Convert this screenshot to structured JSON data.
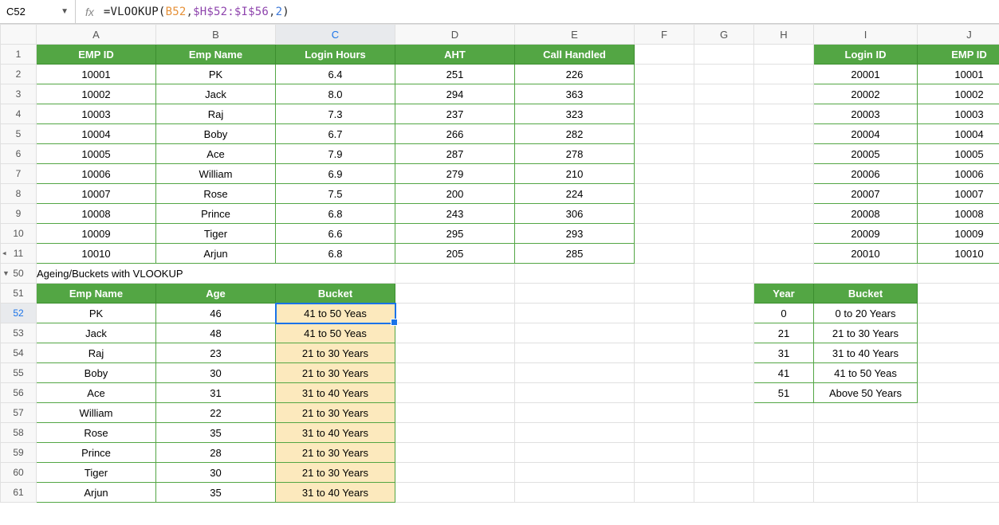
{
  "namebox": "C52",
  "fx_label": "fx",
  "formula": {
    "fn": "=VLOOKUP",
    "arg1": "B52",
    "arg2": "$H$52:$I$56",
    "arg3": "2"
  },
  "col_letters": [
    "A",
    "B",
    "C",
    "D",
    "E",
    "F",
    "G",
    "H",
    "I",
    "J"
  ],
  "rows_top": [
    "1",
    "2",
    "3",
    "4",
    "5",
    "6",
    "7",
    "8",
    "9",
    "10",
    "11"
  ],
  "rows_bottom": [
    "50",
    "51",
    "52",
    "53",
    "54",
    "55",
    "56",
    "57",
    "58",
    "59",
    "60",
    "61"
  ],
  "top_headers1": [
    "EMP ID",
    "Emp Name",
    "Login Hours",
    "AHT",
    "Call Handled"
  ],
  "top_headers2": [
    "Login ID",
    "EMP ID"
  ],
  "top_data1": [
    [
      "10001",
      "PK",
      "6.4",
      "251",
      "226"
    ],
    [
      "10002",
      "Jack",
      "8.0",
      "294",
      "363"
    ],
    [
      "10003",
      "Raj",
      "7.3",
      "237",
      "323"
    ],
    [
      "10004",
      "Boby",
      "6.7",
      "266",
      "282"
    ],
    [
      "10005",
      "Ace",
      "7.9",
      "287",
      "278"
    ],
    [
      "10006",
      "William",
      "6.9",
      "279",
      "210"
    ],
    [
      "10007",
      "Rose",
      "7.5",
      "200",
      "224"
    ],
    [
      "10008",
      "Prince",
      "6.8",
      "243",
      "306"
    ],
    [
      "10009",
      "Tiger",
      "6.6",
      "295",
      "293"
    ],
    [
      "10010",
      "Arjun",
      "6.8",
      "205",
      "285"
    ]
  ],
  "top_data2": [
    [
      "20001",
      "10001"
    ],
    [
      "20002",
      "10002"
    ],
    [
      "20003",
      "10003"
    ],
    [
      "20004",
      "10004"
    ],
    [
      "20005",
      "10005"
    ],
    [
      "20006",
      "10006"
    ],
    [
      "20007",
      "10007"
    ],
    [
      "20008",
      "10008"
    ],
    [
      "20009",
      "10009"
    ],
    [
      "20010",
      "10010"
    ]
  ],
  "ageing_title": "Ageing/Buckets with VLOOKUP",
  "bottom_headers1": [
    "Emp Name",
    "Age",
    "Bucket"
  ],
  "bottom_headers2": [
    "Year",
    "Bucket"
  ],
  "bottom_data1": [
    [
      "PK",
      "46",
      "41 to 50 Yeas"
    ],
    [
      "Jack",
      "48",
      "41 to 50 Yeas"
    ],
    [
      "Raj",
      "23",
      "21 to 30 Years"
    ],
    [
      "Boby",
      "30",
      "21 to 30 Years"
    ],
    [
      "Ace",
      "31",
      "31 to 40 Years"
    ],
    [
      "William",
      "22",
      "21 to 30 Years"
    ],
    [
      "Rose",
      "35",
      "31 to 40 Years"
    ],
    [
      "Prince",
      "28",
      "21 to 30 Years"
    ],
    [
      "Tiger",
      "30",
      "21 to 30 Years"
    ],
    [
      "Arjun",
      "35",
      "31 to 40 Years"
    ]
  ],
  "bottom_data2": [
    [
      "0",
      "0 to 20 Years"
    ],
    [
      "21",
      "21 to 30 Years"
    ],
    [
      "31",
      "31 to 40 Years"
    ],
    [
      "41",
      "41 to 50 Yeas"
    ],
    [
      "51",
      "Above 50 Years"
    ]
  ],
  "colw": {
    "row": 45,
    "A": 150,
    "B": 150,
    "C": 150,
    "D": 150,
    "E": 150,
    "F": 75,
    "G": 75,
    "H": 75,
    "I": 130,
    "J": 130
  }
}
